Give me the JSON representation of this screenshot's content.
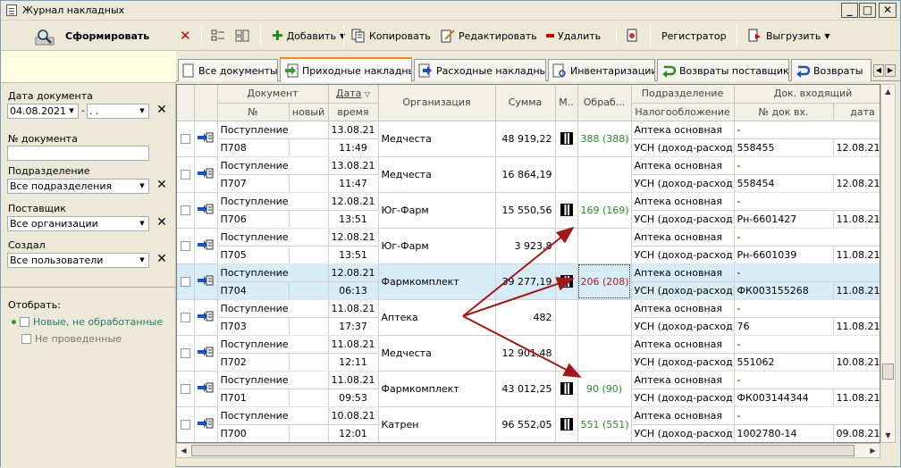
{
  "window": {
    "title": "Журнал накладных"
  },
  "toolbar": {
    "form_label": "Сформировать",
    "add_label": "Добавить",
    "copy_label": "Копировать",
    "edit_label": "Редактировать",
    "delete_label": "Удалить",
    "registrar_label": "Регистратор",
    "export_label": "Выгрузить"
  },
  "filters": {
    "date_label": "Дата документа",
    "date_from": "04.08.2021",
    "date_to": ". .",
    "docnum_label": "№ документа",
    "docnum_value": "",
    "subdivision_label": "Подразделение",
    "subdivision_value": "Все подразделения",
    "supplier_label": "Поставщик",
    "supplier_value": "Все организации",
    "creator_label": "Создал",
    "creator_value": "Все пользователи",
    "select_label": "Отобрать:",
    "opt_new": "Новые, не обработанные",
    "opt_unposted": "Не проведенные"
  },
  "tabs": [
    "Все документы",
    "Приходные накладные",
    "Расходные накладные",
    "Инвентаризации",
    "Возвраты поставщику",
    "Возвраты"
  ],
  "columns": {
    "doc": "Документ",
    "num": "№",
    "new": "новый",
    "date": "Дата",
    "time": "время",
    "org": "Организация",
    "sum": "Сумма",
    "m": "М..",
    "proc": "Обраб...",
    "subdiv": "Подразделение",
    "tax": "Налогообложение",
    "incoming": "Док. входящий",
    "incnum": "№ док вх.",
    "incdate": "дата"
  },
  "rows": [
    {
      "type": "Поступление",
      "num": "П708",
      "date": "13.08.21",
      "time": "11:49",
      "org": "Медчеста",
      "sum": "48 919,22",
      "qr": true,
      "proc": "388 (388)",
      "proc_color": "green",
      "subdiv": "Аптека основная",
      "tax": "УСН (доход-расход)",
      "inc1": "-",
      "incnum": "558455",
      "incdate": "12.08.21"
    },
    {
      "type": "Поступление",
      "num": "П707",
      "date": "13.08.21",
      "time": "11:47",
      "org": "Медчеста",
      "sum": "16 864,19",
      "qr": false,
      "proc": "",
      "proc_color": "green",
      "subdiv": "Аптека основная",
      "tax": "УСН (доход-расход)",
      "inc1": "-",
      "incnum": "558454",
      "incdate": "12.08.21"
    },
    {
      "type": "Поступление",
      "num": "П706",
      "date": "12.08.21",
      "time": "13:51",
      "org": "Юг-Фарм",
      "sum": "15 550,56",
      "qr": true,
      "proc": "169 (169)",
      "proc_color": "green",
      "subdiv": "Аптека основная",
      "tax": "УСН (доход-расход)",
      "inc1": "-",
      "incnum": "Рн-6601427",
      "incdate": "11.08.21"
    },
    {
      "type": "Поступление",
      "num": "П705",
      "date": "12.08.21",
      "time": "13:51",
      "org": "Юг-Фарм",
      "sum": "3 923,8",
      "qr": false,
      "proc": "",
      "proc_color": "green",
      "subdiv": "Аптека основная",
      "tax": "УСН (доход-расход)",
      "inc1": "-",
      "incnum": "Рн-6601039",
      "incdate": "11.08.21"
    },
    {
      "type": "Поступление",
      "num": "П704",
      "date": "12.08.21",
      "time": "06:13",
      "org": "Фармкомплект",
      "sum": "39 277,19",
      "qr": true,
      "proc": "206 (208)",
      "proc_color": "red",
      "subdiv": "Аптека основная",
      "tax": "УСН (доход-расход)",
      "inc1": "-",
      "incnum": "ФК003155268",
      "incdate": "11.08.21",
      "selected": true
    },
    {
      "type": "Поступление",
      "num": "П703",
      "date": "11.08.21",
      "time": "17:37",
      "org": "Аптека",
      "sum": "482",
      "qr": false,
      "proc": "",
      "proc_color": "green",
      "subdiv": "Аптека основная",
      "tax": "УСН (доход-расход)",
      "inc1": "-",
      "incnum": "76",
      "incdate": "11.08.21"
    },
    {
      "type": "Поступление",
      "num": "П702",
      "date": "11.08.21",
      "time": "12:11",
      "org": "Медчеста",
      "sum": "12 901,48",
      "qr": false,
      "proc": "",
      "proc_color": "green",
      "subdiv": "Аптека основная",
      "tax": "УСН (доход-расход)",
      "inc1": "-",
      "incnum": "551062",
      "incdate": "10.08.21"
    },
    {
      "type": "Поступление",
      "num": "П701",
      "date": "11.08.21",
      "time": "09:53",
      "org": "Фармкомплект",
      "sum": "43 012,25",
      "qr": true,
      "proc": "90 (90)",
      "proc_color": "green",
      "subdiv": "Аптека основная",
      "tax": "УСН (доход-расход)",
      "inc1": "-",
      "incnum": "ФК003144344",
      "incdate": "11.08.21"
    },
    {
      "type": "Поступление",
      "num": "П700",
      "date": "10.08.21",
      "time": "12:01",
      "org": "Катрен",
      "sum": "96 552,05",
      "qr": true,
      "proc": "551 (551)",
      "proc_color": "green",
      "subdiv": "Аптека основная",
      "tax": "УСН (доход-расход)",
      "inc1": "-",
      "incnum": "1002780-14",
      "incdate": "09.08.21"
    }
  ],
  "colors": {
    "accent": "#e68b2c",
    "arrow": "#a01818",
    "selected_row": "#d8ecf8",
    "green_text": "#2a8a2a",
    "red_text": "#b02020"
  }
}
